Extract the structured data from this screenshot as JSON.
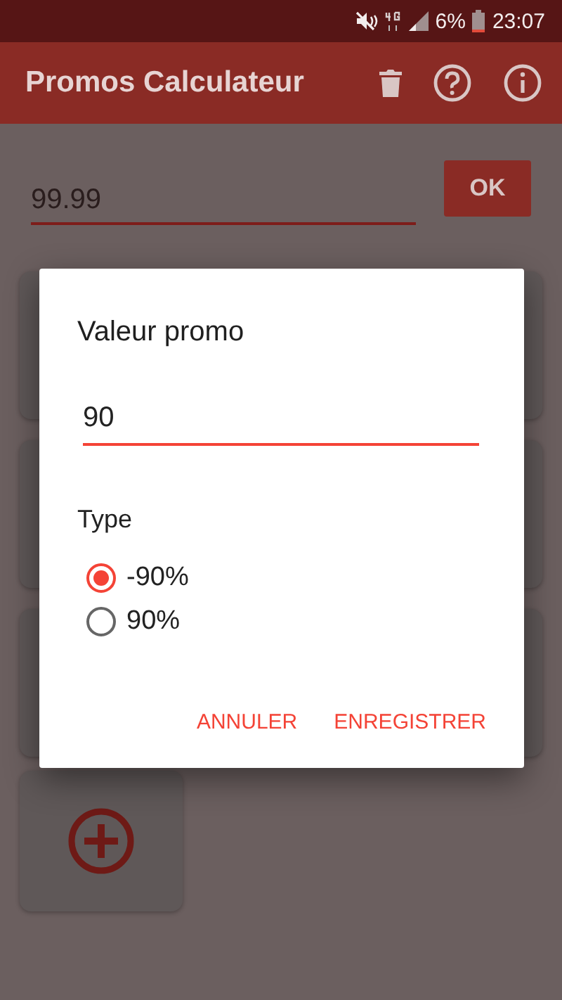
{
  "status_bar": {
    "battery": "6%",
    "time": "23:07"
  },
  "app_bar": {
    "title": "Promos Calculateur"
  },
  "price_input": {
    "value": "99.99"
  },
  "ok_button": "OK",
  "cards": [
    {
      "kind": "promo"
    },
    {
      "kind": "promo"
    },
    {
      "kind": "promo"
    },
    {
      "kind": "add"
    }
  ],
  "dialog": {
    "title": "Valeur promo",
    "value": "90",
    "type_label": "Type",
    "options": [
      {
        "label": "-90%",
        "selected": true
      },
      {
        "label": "90%",
        "selected": false
      }
    ],
    "buttons": [
      "ANNULER",
      "ENREGISTRER"
    ]
  }
}
